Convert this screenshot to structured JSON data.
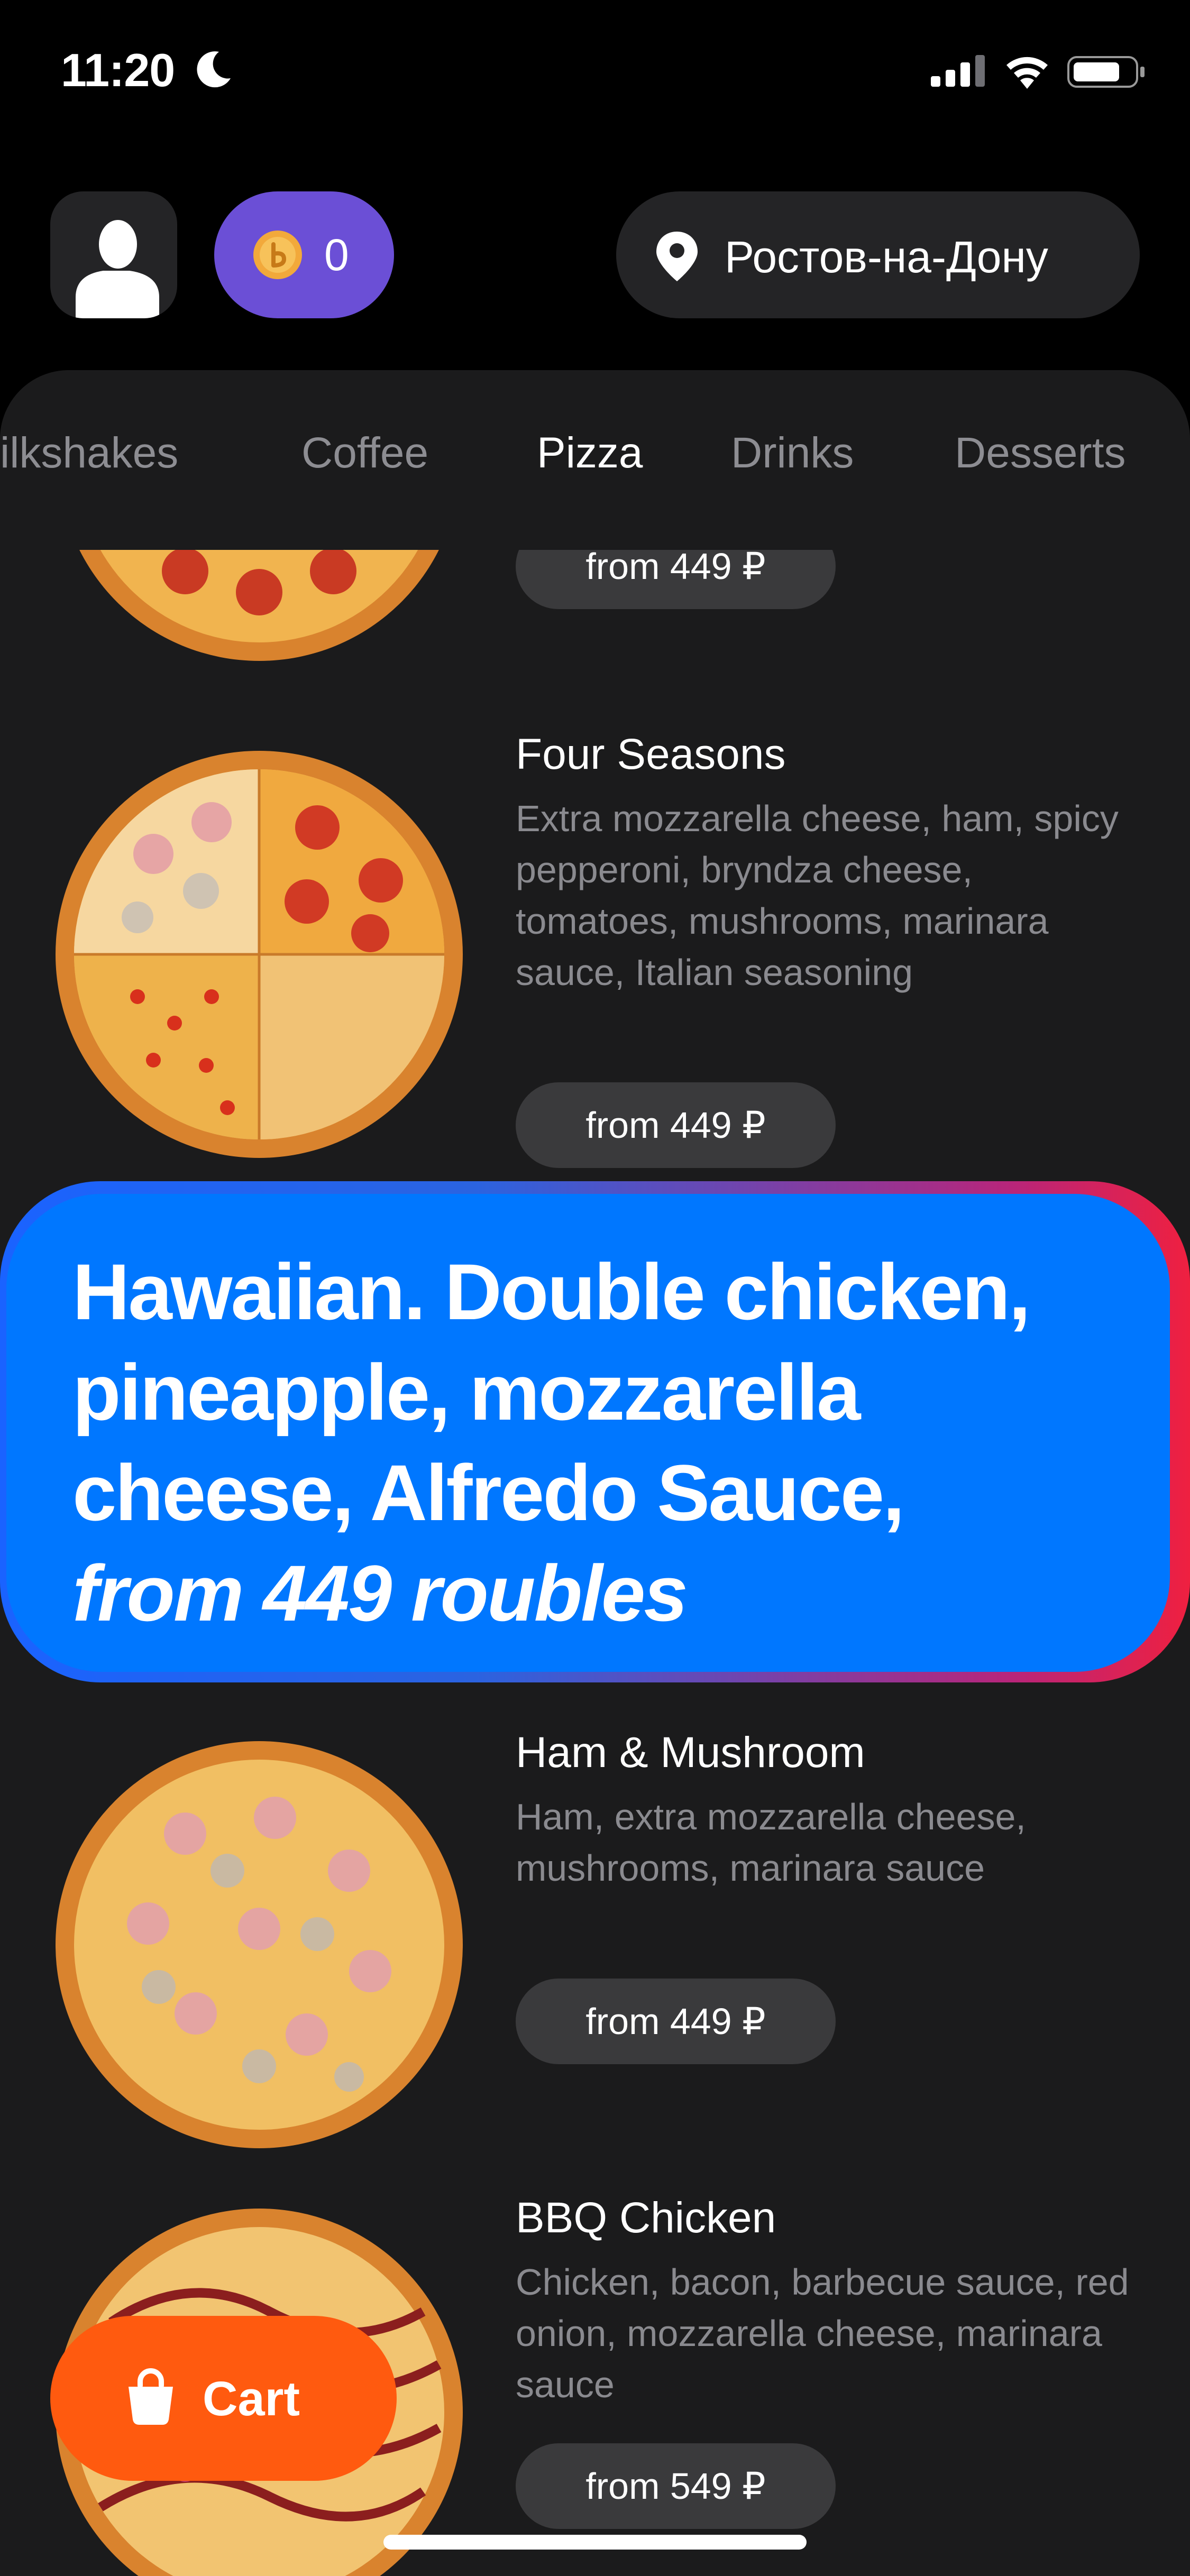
{
  "status_bar": {
    "time": "11:20"
  },
  "header": {
    "coins": "0",
    "city": "Ростов-на-Дону"
  },
  "tabs": [
    {
      "label": "ilkshakes",
      "active": false
    },
    {
      "label": "Coffee",
      "active": false
    },
    {
      "label": "Pizza",
      "active": true
    },
    {
      "label": "Drinks",
      "active": false
    },
    {
      "label": "Desserts",
      "active": false
    }
  ],
  "products": [
    {
      "title": "",
      "description": "",
      "price": "from 449 ₽"
    },
    {
      "title": "Four Seasons",
      "description": "Extra mozzarella cheese, ham, spicy pepperoni, bryndza cheese, tomatoes, mushrooms, marinara sauce, Italian seasoning",
      "price": "from 449 ₽"
    },
    {
      "title": "Ham & Mushroom",
      "description": "Ham, extra mozzarella cheese, mushrooms, marinara sauce",
      "price": "from 449 ₽"
    },
    {
      "title": "BBQ Chicken",
      "description": "Chicken, bacon, barbecue sauce, red onion, mozzarella cheese, marinara sauce",
      "price": "from 549 ₽"
    }
  ],
  "banner": {
    "text": "Hawaiian. Double chicken, pineapple, mozzarella cheese, Alfredo Sauce,",
    "price_text": "from 449 roubles"
  },
  "cart": {
    "label": "Cart"
  },
  "colors": {
    "accent_cart": "#ff5a0f",
    "banner_blue": "#0077ff",
    "coins_purple": "#6b4fd6"
  }
}
